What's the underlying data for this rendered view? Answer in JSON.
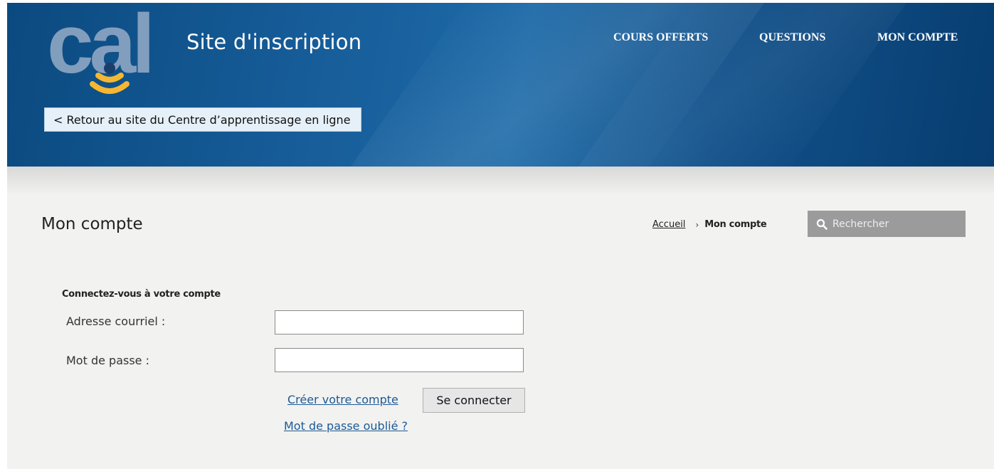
{
  "header": {
    "logo_text": "cal",
    "site_title": "Site d'inscription",
    "nav": [
      {
        "label": "COURS OFFERTS"
      },
      {
        "label": "QUESTIONS"
      },
      {
        "label": "MON COMPTE"
      }
    ],
    "back_link": "< Retour au site du Centre d’apprentissage en ligne"
  },
  "colors": {
    "header_blue": "#165c98",
    "logo_gray": "#8fa7c4",
    "logo_accent": "#f5b731",
    "link_blue": "#1d5a96",
    "search_bg": "#9b9b9b"
  },
  "page": {
    "title": "Mon compte",
    "breadcrumb": {
      "home": "Accueil",
      "separator": "›",
      "current": "Mon compte"
    },
    "search": {
      "icon": "search-icon",
      "placeholder": "Rechercher"
    }
  },
  "login_form": {
    "heading": "Connectez-vous à votre compte",
    "email_label": "Adresse courriel :",
    "email_value": "",
    "password_label": "Mot de passe :",
    "password_value": "",
    "create_account": "Créer votre compte",
    "submit": "Se connecter",
    "forgot_password": "Mot de passe oublié ?"
  }
}
